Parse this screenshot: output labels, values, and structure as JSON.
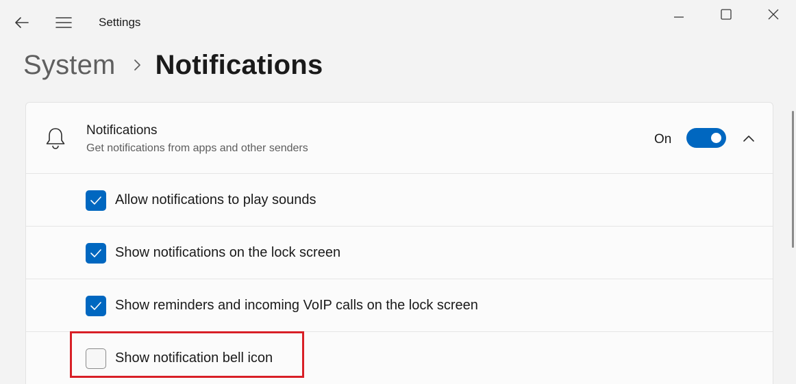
{
  "window": {
    "title": "Settings",
    "icons": {
      "back": "back-arrow-icon",
      "menu": "hamburger-menu-icon",
      "minimize": "minimize-icon",
      "maximize": "maximize-icon",
      "close": "close-icon"
    }
  },
  "breadcrumb": {
    "parent": "System",
    "separator_icon": "chevron-right-icon",
    "current": "Notifications"
  },
  "notifications_card": {
    "icon": "bell-icon",
    "title": "Notifications",
    "subtitle": "Get notifications from apps and other senders",
    "toggle_state_label": "On",
    "toggle_on": true,
    "expanded": true,
    "expand_icon": "chevron-up-icon",
    "options": [
      {
        "label": "Allow notifications to play sounds",
        "checked": true
      },
      {
        "label": "Show notifications on the lock screen",
        "checked": true
      },
      {
        "label": "Show reminders and incoming VoIP calls on the lock screen",
        "checked": true
      },
      {
        "label": "Show notification bell icon",
        "checked": false
      }
    ]
  },
  "colors": {
    "accent": "#0067c0",
    "highlight": "#d81f26",
    "background": "#f3f3f3",
    "card": "#fbfbfb"
  }
}
